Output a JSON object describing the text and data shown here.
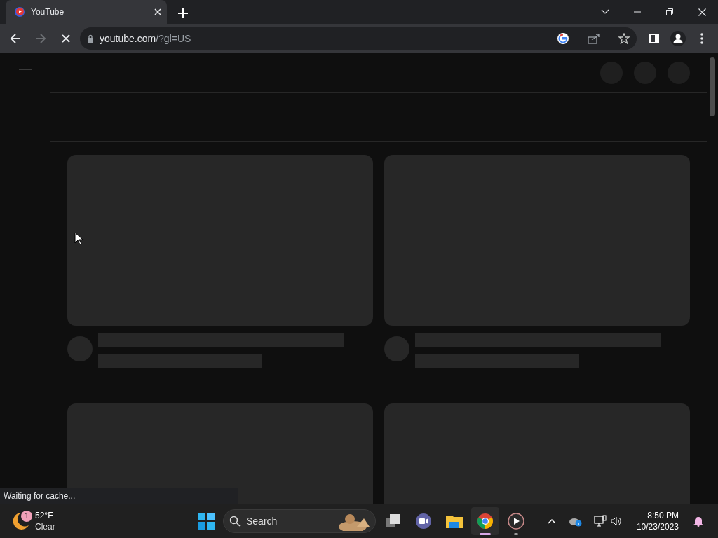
{
  "browser": {
    "tabs": [
      {
        "title": "YouTube",
        "selected": true
      }
    ],
    "address_bar": {
      "host": "youtube.com",
      "path": "/?gl=US"
    },
    "loading": true,
    "status_text": "Waiting for cache..."
  },
  "taskbar": {
    "weather": {
      "badge": "1",
      "temperature": "52°F",
      "condition": "Clear"
    },
    "search": {
      "placeholder": "Search"
    },
    "apps": [
      {
        "kind": "taskview",
        "selected": false,
        "running": false
      },
      {
        "kind": "meet",
        "selected": false,
        "running": false
      },
      {
        "kind": "explorer",
        "selected": false,
        "running": false
      },
      {
        "kind": "chrome",
        "selected": true,
        "running": true
      },
      {
        "kind": "player",
        "selected": false,
        "running": true
      }
    ],
    "time": "8:50 PM",
    "date": "10/23/2023"
  }
}
